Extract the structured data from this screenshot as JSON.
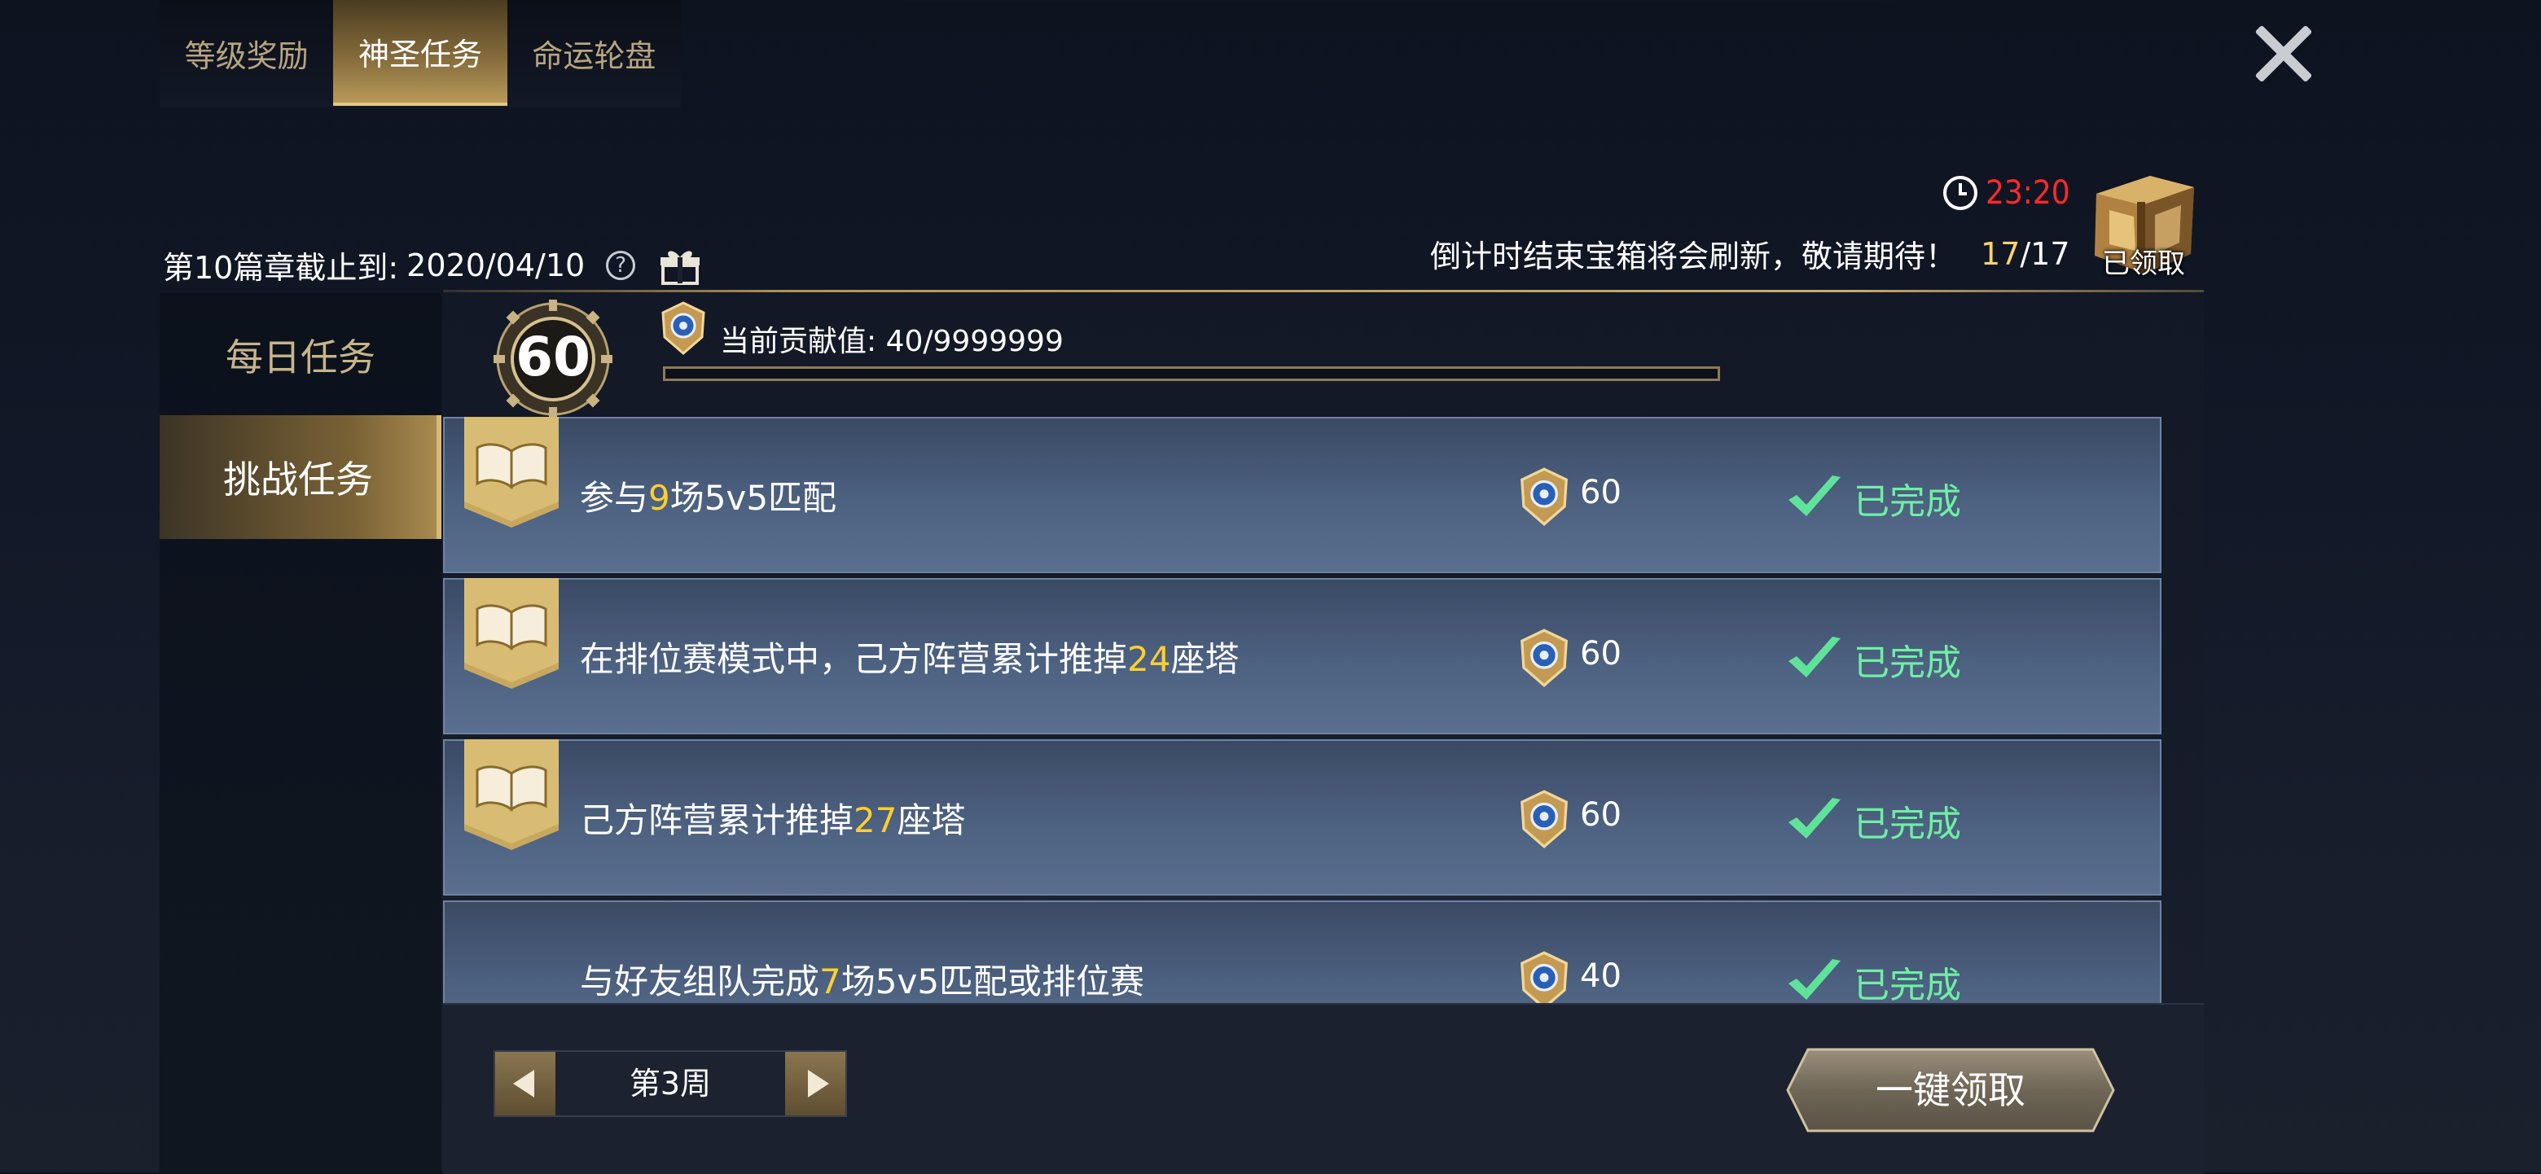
{
  "top_tabs": [
    {
      "label": "等级奖励",
      "active": false
    },
    {
      "label": "神圣任务",
      "active": true
    },
    {
      "label": "命运轮盘",
      "active": false
    }
  ],
  "chapter": {
    "prefix": "第10篇章截止到:",
    "date": "2020/04/10"
  },
  "timer": {
    "value": "23:20"
  },
  "refresh_note": "倒计时结束宝箱将会刷新，敬请期待！",
  "chest": {
    "count": "17",
    "total": "/17",
    "label": "已领取"
  },
  "side_menu": [
    {
      "label": "每日任务",
      "active": false
    },
    {
      "label": "挑战任务",
      "active": true
    }
  ],
  "level": "60",
  "contribution": {
    "label": "当前贡献值:",
    "value": "40/9999999",
    "progress": 4e-06
  },
  "tasks": [
    {
      "parts": [
        "参与",
        "9",
        "场5v5匹配"
      ],
      "reward": "60",
      "status": "已完成"
    },
    {
      "parts": [
        "在排位赛模式中，己方阵营累计推掉",
        "24",
        "座塔"
      ],
      "reward": "60",
      "status": "已完成"
    },
    {
      "parts": [
        "己方阵营累计推掉",
        "27",
        "座塔"
      ],
      "reward": "60",
      "status": "已完成"
    },
    {
      "parts": [
        "与好友组队完成",
        "7",
        "场5v5匹配或排位赛"
      ],
      "reward": "40",
      "status": "已完成"
    }
  ],
  "week": {
    "label": "第3周"
  },
  "claim_all_label": "一键领取",
  "colors": {
    "gold": "#c9a55a",
    "timer_red": "#ff2a2a",
    "highlight": "#ffcf2e",
    "done_green": "#6ef0a4"
  }
}
